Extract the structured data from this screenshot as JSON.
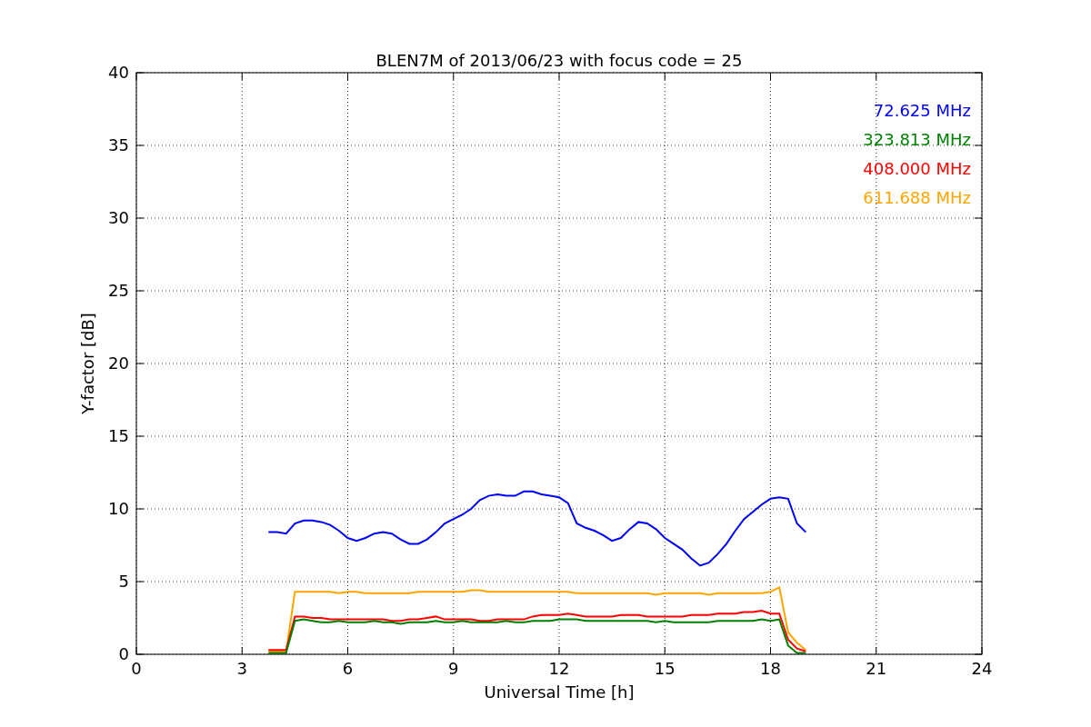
{
  "figure": {
    "chart_data": {
      "type": "line",
      "title": "BLEN7M of 2013/06/23 with focus code = 25",
      "xlabel": "Universal Time [h]",
      "ylabel": "Y-factor [dB]",
      "xlim": [
        0,
        24
      ],
      "ylim": [
        0,
        40
      ],
      "xticks": [
        0,
        3,
        6,
        9,
        12,
        15,
        18,
        21,
        24
      ],
      "yticks": [
        0,
        5,
        10,
        15,
        20,
        25,
        30,
        35,
        40
      ],
      "grid": true,
      "x": [
        3.75,
        4.0,
        4.25,
        4.5,
        4.75,
        5.0,
        5.25,
        5.5,
        5.75,
        6.0,
        6.25,
        6.5,
        6.75,
        7.0,
        7.25,
        7.5,
        7.75,
        8.0,
        8.25,
        8.5,
        8.75,
        9.0,
        9.25,
        9.5,
        9.75,
        10.0,
        10.25,
        10.5,
        10.75,
        11.0,
        11.25,
        11.5,
        11.75,
        12.0,
        12.25,
        12.5,
        12.75,
        13.0,
        13.25,
        13.5,
        13.75,
        14.0,
        14.25,
        14.5,
        14.75,
        15.0,
        15.25,
        15.5,
        15.75,
        16.0,
        16.25,
        16.5,
        16.75,
        17.0,
        17.25,
        17.5,
        17.75,
        18.0,
        18.25,
        18.5,
        18.75,
        19.0
      ],
      "series": [
        {
          "name": "72.625 MHz",
          "color": "#0000ff",
          "values": [
            8.4,
            8.4,
            8.3,
            9.0,
            9.2,
            9.2,
            9.1,
            8.9,
            8.5,
            8.0,
            7.8,
            8.0,
            8.3,
            8.4,
            8.3,
            7.9,
            7.6,
            7.6,
            7.9,
            8.4,
            9.0,
            9.3,
            9.6,
            10.0,
            10.6,
            10.9,
            11.0,
            10.9,
            10.9,
            11.2,
            11.2,
            11.0,
            10.9,
            10.8,
            10.4,
            9.0,
            8.7,
            8.5,
            8.2,
            7.8,
            8.0,
            8.6,
            9.1,
            9.0,
            8.6,
            8.0,
            7.6,
            7.2,
            6.6,
            6.1,
            6.3,
            6.9,
            7.6,
            8.5,
            9.3,
            9.8,
            10.3,
            10.7,
            10.8,
            10.7,
            9.0,
            8.4
          ]
        },
        {
          "name": "323.813 MHz",
          "color": "#008000",
          "values": [
            0.1,
            0.1,
            0.1,
            2.3,
            2.4,
            2.3,
            2.2,
            2.2,
            2.3,
            2.2,
            2.2,
            2.2,
            2.3,
            2.2,
            2.2,
            2.1,
            2.2,
            2.2,
            2.2,
            2.3,
            2.2,
            2.2,
            2.3,
            2.2,
            2.2,
            2.2,
            2.2,
            2.3,
            2.2,
            2.2,
            2.3,
            2.3,
            2.3,
            2.4,
            2.4,
            2.4,
            2.3,
            2.3,
            2.3,
            2.3,
            2.3,
            2.3,
            2.3,
            2.3,
            2.2,
            2.3,
            2.2,
            2.2,
            2.2,
            2.2,
            2.2,
            2.3,
            2.3,
            2.3,
            2.3,
            2.3,
            2.4,
            2.3,
            2.4,
            0.6,
            0.1,
            0.1
          ]
        },
        {
          "name": "408.000 MHz",
          "color": "#ff0000",
          "values": [
            0.3,
            0.3,
            0.3,
            2.6,
            2.6,
            2.5,
            2.5,
            2.4,
            2.4,
            2.4,
            2.4,
            2.4,
            2.4,
            2.4,
            2.3,
            2.3,
            2.4,
            2.4,
            2.5,
            2.6,
            2.4,
            2.4,
            2.4,
            2.4,
            2.3,
            2.3,
            2.4,
            2.4,
            2.4,
            2.4,
            2.6,
            2.7,
            2.7,
            2.7,
            2.8,
            2.7,
            2.6,
            2.6,
            2.6,
            2.6,
            2.7,
            2.7,
            2.7,
            2.6,
            2.6,
            2.6,
            2.6,
            2.6,
            2.7,
            2.7,
            2.7,
            2.8,
            2.8,
            2.8,
            2.9,
            2.9,
            3.0,
            2.8,
            2.8,
            1.0,
            0.4,
            0.2
          ]
        },
        {
          "name": "611.688 MHz",
          "color": "#ffa500",
          "values": [
            0.2,
            0.2,
            0.2,
            4.3,
            4.3,
            4.3,
            4.3,
            4.3,
            4.2,
            4.3,
            4.3,
            4.2,
            4.2,
            4.2,
            4.2,
            4.2,
            4.2,
            4.3,
            4.3,
            4.3,
            4.3,
            4.3,
            4.3,
            4.4,
            4.4,
            4.3,
            4.3,
            4.3,
            4.3,
            4.3,
            4.3,
            4.3,
            4.3,
            4.3,
            4.3,
            4.2,
            4.2,
            4.2,
            4.2,
            4.2,
            4.2,
            4.2,
            4.2,
            4.2,
            4.1,
            4.2,
            4.2,
            4.2,
            4.2,
            4.2,
            4.1,
            4.2,
            4.2,
            4.2,
            4.2,
            4.2,
            4.2,
            4.3,
            4.6,
            1.5,
            0.8,
            0.3
          ]
        }
      ]
    }
  }
}
